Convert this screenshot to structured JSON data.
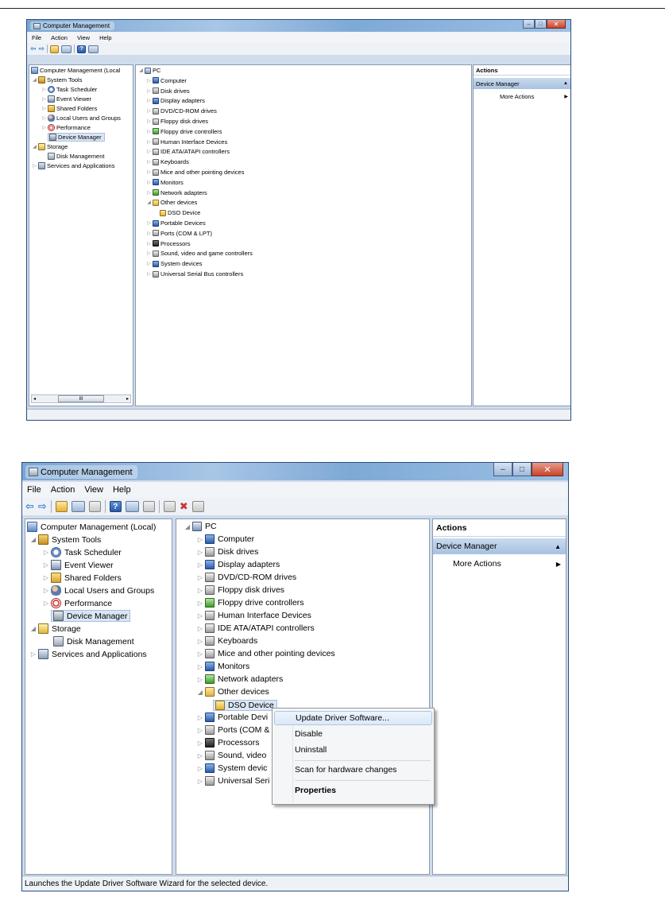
{
  "top": {
    "title": "Computer Management",
    "menu": [
      "File",
      "Action",
      "View",
      "Help"
    ],
    "tree": [
      {
        "label": "Computer Management (Local",
        "icon": "computer-management-icon"
      },
      {
        "label": "System Tools",
        "icon": "system-tools-icon"
      },
      {
        "label": "Task Scheduler",
        "icon": "task-scheduler-icon"
      },
      {
        "label": "Event Viewer",
        "icon": "event-viewer-icon"
      },
      {
        "label": "Shared Folders",
        "icon": "shared-folders-icon"
      },
      {
        "label": "Local Users and Groups",
        "icon": "local-users-icon"
      },
      {
        "label": "Performance",
        "icon": "performance-icon"
      },
      {
        "label": "Device Manager",
        "icon": "device-manager-icon"
      },
      {
        "label": "Storage",
        "icon": "storage-icon"
      },
      {
        "label": "Disk Management",
        "icon": "disk-management-icon"
      },
      {
        "label": "Services and Applications",
        "icon": "services-icon"
      }
    ],
    "devices": [
      {
        "label": "PC",
        "icon": "pc-icon"
      },
      {
        "label": "Computer",
        "icon": "computer-icon"
      },
      {
        "label": "Disk drives",
        "icon": "disk-drive-icon"
      },
      {
        "label": "Display adapters",
        "icon": "display-adapter-icon"
      },
      {
        "label": "DVD/CD-ROM drives",
        "icon": "dvd-drive-icon"
      },
      {
        "label": "Floppy disk drives",
        "icon": "floppy-drive-icon"
      },
      {
        "label": "Floppy drive controllers",
        "icon": "floppy-controller-icon"
      },
      {
        "label": "Human Interface Devices",
        "icon": "hid-icon"
      },
      {
        "label": "IDE ATA/ATAPI controllers",
        "icon": "ide-controller-icon"
      },
      {
        "label": "Keyboards",
        "icon": "keyboard-icon"
      },
      {
        "label": "Mice and other pointing devices",
        "icon": "mouse-icon"
      },
      {
        "label": "Monitors",
        "icon": "monitor-icon"
      },
      {
        "label": "Network adapters",
        "icon": "network-adapter-icon"
      },
      {
        "label": "Other devices",
        "icon": "other-devices-icon"
      },
      {
        "label": "DSO Device",
        "icon": "warning-device-icon"
      },
      {
        "label": "Portable Devices",
        "icon": "portable-device-icon"
      },
      {
        "label": "Ports (COM & LPT)",
        "icon": "port-icon"
      },
      {
        "label": "Processors",
        "icon": "processor-icon"
      },
      {
        "label": "Sound, video and game controllers",
        "icon": "sound-icon"
      },
      {
        "label": "System devices",
        "icon": "system-device-icon"
      },
      {
        "label": "Universal Serial Bus controllers",
        "icon": "usb-icon"
      }
    ],
    "actions": {
      "header": "Actions",
      "section": "Device Manager",
      "item": "More Actions"
    },
    "scrollbar_thumb": "III"
  },
  "bottom": {
    "title": "Computer Management",
    "menu": [
      "File",
      "Action",
      "View",
      "Help"
    ],
    "tree": [
      {
        "label": "Computer Management (Local)"
      },
      {
        "label": "System Tools"
      },
      {
        "label": "Task Scheduler"
      },
      {
        "label": "Event Viewer"
      },
      {
        "label": "Shared Folders"
      },
      {
        "label": "Local Users and Groups"
      },
      {
        "label": "Performance"
      },
      {
        "label": "Device Manager"
      },
      {
        "label": "Storage"
      },
      {
        "label": "Disk Management"
      },
      {
        "label": "Services and Applications"
      }
    ],
    "devices": [
      {
        "label": "PC"
      },
      {
        "label": "Computer"
      },
      {
        "label": "Disk drives"
      },
      {
        "label": "Display adapters"
      },
      {
        "label": "DVD/CD-ROM drives"
      },
      {
        "label": "Floppy disk drives"
      },
      {
        "label": "Floppy drive controllers"
      },
      {
        "label": "Human Interface Devices"
      },
      {
        "label": "IDE ATA/ATAPI controllers"
      },
      {
        "label": "Keyboards"
      },
      {
        "label": "Mice and other pointing devices"
      },
      {
        "label": "Monitors"
      },
      {
        "label": "Network adapters"
      },
      {
        "label": "Other devices"
      },
      {
        "label": "DSO Device"
      },
      {
        "label": "Portable Devi"
      },
      {
        "label": "Ports (COM &"
      },
      {
        "label": "Processors"
      },
      {
        "label": "Sound, video"
      },
      {
        "label": "System devic"
      },
      {
        "label": "Universal Seri"
      }
    ],
    "actions": {
      "header": "Actions",
      "section": "Device Manager",
      "item": "More Actions"
    },
    "context_menu": {
      "update": "Update Driver Software...",
      "disable": "Disable",
      "uninstall": "Uninstall",
      "scan": "Scan for hardware changes",
      "properties": "Properties"
    },
    "status": "Launches the Update Driver Software Wizard for the selected device."
  },
  "colors": {
    "selection": "#dbe6f4",
    "titlebar": "#7aa6d4",
    "close_button": "#c8452c",
    "actions_section": "#b8cde7"
  }
}
